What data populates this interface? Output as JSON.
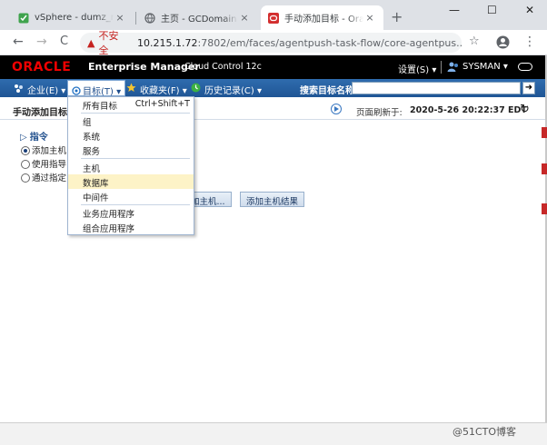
{
  "browser": {
    "tabs": [
      {
        "title": "vSphere - dumz_rhel",
        "close": "×"
      },
      {
        "title": "主页 - GCDomain - C",
        "close": "×"
      },
      {
        "title": "手动添加目标 - Oracle",
        "close": "×"
      }
    ],
    "new_tab": "+",
    "window": {
      "minimize": "—",
      "maximize": "☐",
      "close": "✕"
    },
    "nav": {
      "back": "←",
      "forward": "→",
      "reload": "C"
    },
    "address": {
      "warning_icon": "▲",
      "insecure_label": "不安全",
      "host": "10.215.1.72",
      "path": ":7802/em/faces/agentpush-task-flow/core-agentpus..."
    },
    "toolbar": {
      "star": "☆",
      "menu": "⋮"
    }
  },
  "em_header": {
    "logo": "ORACLE",
    "product": "Enterprise Manager",
    "edition": "Cloud Control 12c",
    "settings": "设置(S) ▾",
    "user": "SYSMAN ▾"
  },
  "menubar": {
    "items": [
      {
        "label": "企业(E) ▾"
      },
      {
        "label": "目标(T) ▾"
      },
      {
        "label": "收藏夹(F) ▾"
      },
      {
        "label": "历史记录(C) ▾"
      }
    ],
    "search_label": "搜索目标名称",
    "search_value": "",
    "go": "➜"
  },
  "page": {
    "title": "手动添加目标",
    "refresh_label": "页面刷新于:",
    "refresh_time": "2020-5-26 20:22:37 EDT",
    "reload": "↻"
  },
  "instructions": {
    "heading": "指令",
    "options": [
      {
        "label": "添加主机",
        "selected": true
      },
      {
        "label": "使用指导",
        "selected": false
      },
      {
        "label": "通过指定",
        "selected": false
      }
    ]
  },
  "buttons": {
    "add_host": "加主机...",
    "add_host_results": "添加主机结果"
  },
  "dropdown": {
    "items": [
      {
        "label": "所有目标",
        "shortcut": "Ctrl+Shift+T"
      },
      {
        "label": "组",
        "shortcut": ""
      },
      {
        "label": "系统",
        "shortcut": ""
      },
      {
        "label": "服务",
        "shortcut": ""
      },
      {
        "label": "主机",
        "shortcut": ""
      },
      {
        "label": "数据库",
        "shortcut": ""
      },
      {
        "label": "中间件",
        "shortcut": ""
      },
      {
        "label": "业务应用程序",
        "shortcut": ""
      },
      {
        "label": "组合应用程序",
        "shortcut": ""
      }
    ],
    "highlighted_index": 5
  },
  "watermark": "@51CTO博客",
  "colors": {
    "menubar": "#2f6cae",
    "oracle_red": "#ee0000",
    "highlight": "#fdf3c7"
  }
}
